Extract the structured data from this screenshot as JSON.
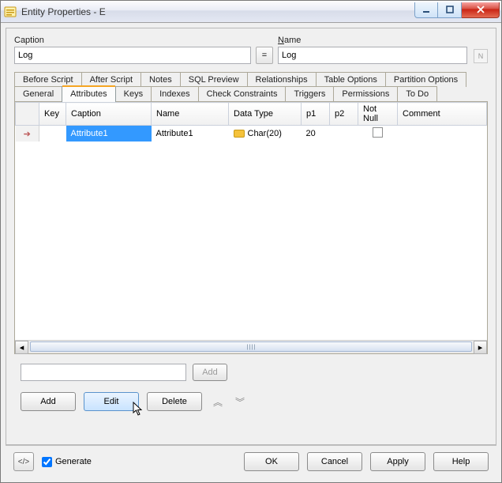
{
  "window_title": "Entity Properties - E",
  "fields": {
    "caption_label": "Caption",
    "name_label_u": "N",
    "name_label_rest": "ame",
    "caption_value": "Log",
    "name_value": "Log",
    "eq_label": "=",
    "aux_label": "N"
  },
  "tabs_row1": [
    "Before Script",
    "After Script",
    "Notes",
    "SQL Preview",
    "Relationships",
    "Table Options",
    "Partition Options"
  ],
  "tabs_row2": [
    "General",
    "Attributes",
    "Keys",
    "Indexes",
    "Check Constraints",
    "Triggers",
    "Permissions",
    "To Do"
  ],
  "active_tab": "Attributes",
  "grid": {
    "headers": [
      "",
      "Key",
      "Caption",
      "Name",
      "Data Type",
      "p1",
      "p2",
      "Not Null",
      "Comment"
    ],
    "row": {
      "arrow": "➔",
      "key": "",
      "caption": "Attribute1",
      "name": "Attribute1",
      "datatype": "Char(20)",
      "p1": "20",
      "p2": "",
      "notnull": false,
      "comment": ""
    }
  },
  "add_small": "Add",
  "buttons_row": {
    "add": "Add",
    "edit": "Edit",
    "delete": "Delete"
  },
  "bottom": {
    "code_label": "</>",
    "generate": "Generate",
    "ok": "OK",
    "cancel": "Cancel",
    "apply": "Apply",
    "help": "Help"
  }
}
